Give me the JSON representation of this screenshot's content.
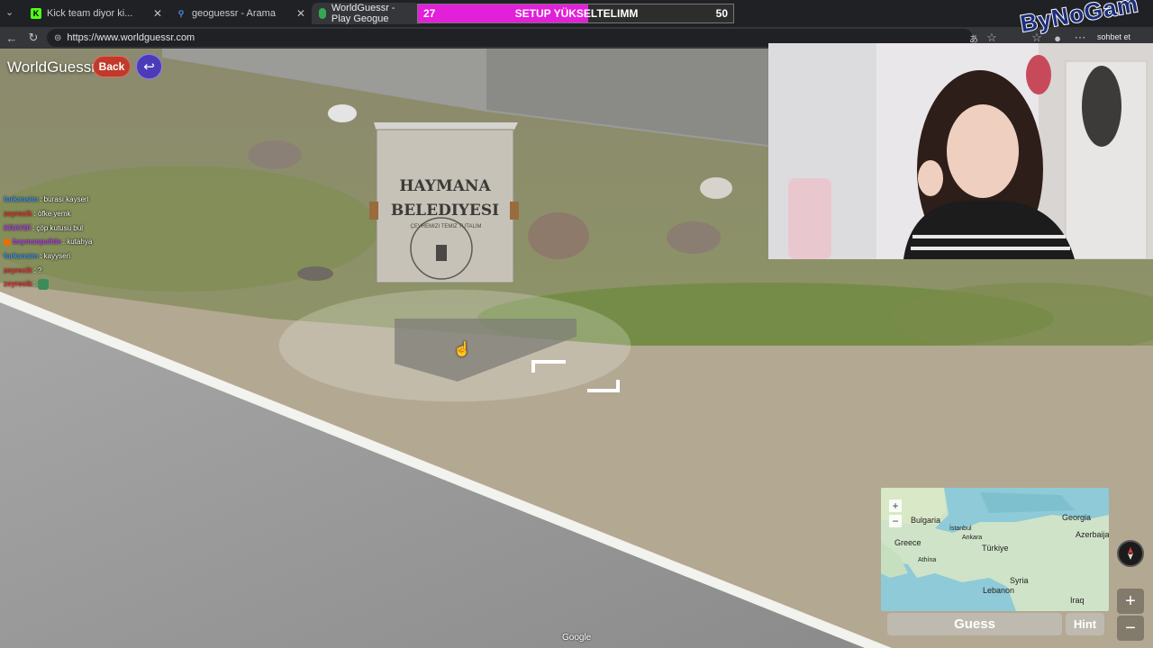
{
  "browser": {
    "tabs": [
      {
        "title": "Kick team diyor ki...",
        "favicon": "kick-icon",
        "color": "#53fc18"
      },
      {
        "title": "geoguessr - Arama",
        "favicon": "search-icon",
        "color": "#4a90e2"
      },
      {
        "title": "WorldGuessr - Play Geogue",
        "favicon": "globe-icon",
        "color": "#34a853"
      }
    ],
    "url": "https://www.worldguessr.com",
    "chat_button_label": "sohbet et"
  },
  "stream_overlay": {
    "goal": {
      "current": "27",
      "label": "SETUP YÜKSELTELIMM",
      "target": "50",
      "progress": 0.54,
      "color": "#e21fd9"
    },
    "watermark": "ByNoGam"
  },
  "game": {
    "logo": "WorldGuessr",
    "back_label": "Back",
    "return_icon": "return-arrow-icon",
    "sign_line1": "HAYMANA",
    "sign_line2": "BELEDIYESI",
    "sign_small": "ÇEVREMIZI TEMIZ TUTALIM",
    "guess_label": "Guess",
    "hint_label": "Hint",
    "google_label": "Google"
  },
  "chat": [
    {
      "user": "furkansim",
      "user_color": "#3c8ce7",
      "text": ": burası kayseri",
      "badge": false,
      "emote": false
    },
    {
      "user": "zeyrecik",
      "user_color": "#e23030",
      "text": ": öfke yemk",
      "badge": false,
      "emote": false
    },
    {
      "user": "KRAYDİ",
      "user_color": "#b040e0",
      "text": ": çöp kutusu bul",
      "badge": false,
      "emote": false
    },
    {
      "user": "baymanpulide",
      "user_color": "#b040e0",
      "text": ": kutahya",
      "badge": true,
      "emote": false
    },
    {
      "user": "furkansim",
      "user_color": "#3c8ce7",
      "text": ": kayyseri",
      "badge": false,
      "emote": false
    },
    {
      "user": "zeyrecik",
      "user_color": "#e23030",
      "text": ": ?",
      "badge": false,
      "emote": false
    },
    {
      "user": "zeyrecik",
      "user_color": "#e23030",
      "text": ":",
      "badge": false,
      "emote": true
    }
  ],
  "minimap": {
    "labels": [
      "Bulgaria",
      "Georgia",
      "İstanbul",
      "Ankara",
      "Greece",
      "Türkiye",
      "Azerbaijan",
      "Athína",
      "Syria",
      "Lebanon",
      "Iraq"
    ],
    "zoom_in": "+",
    "zoom_out": "−"
  },
  "controls": {
    "zoom_in": "+",
    "zoom_out": "−"
  }
}
